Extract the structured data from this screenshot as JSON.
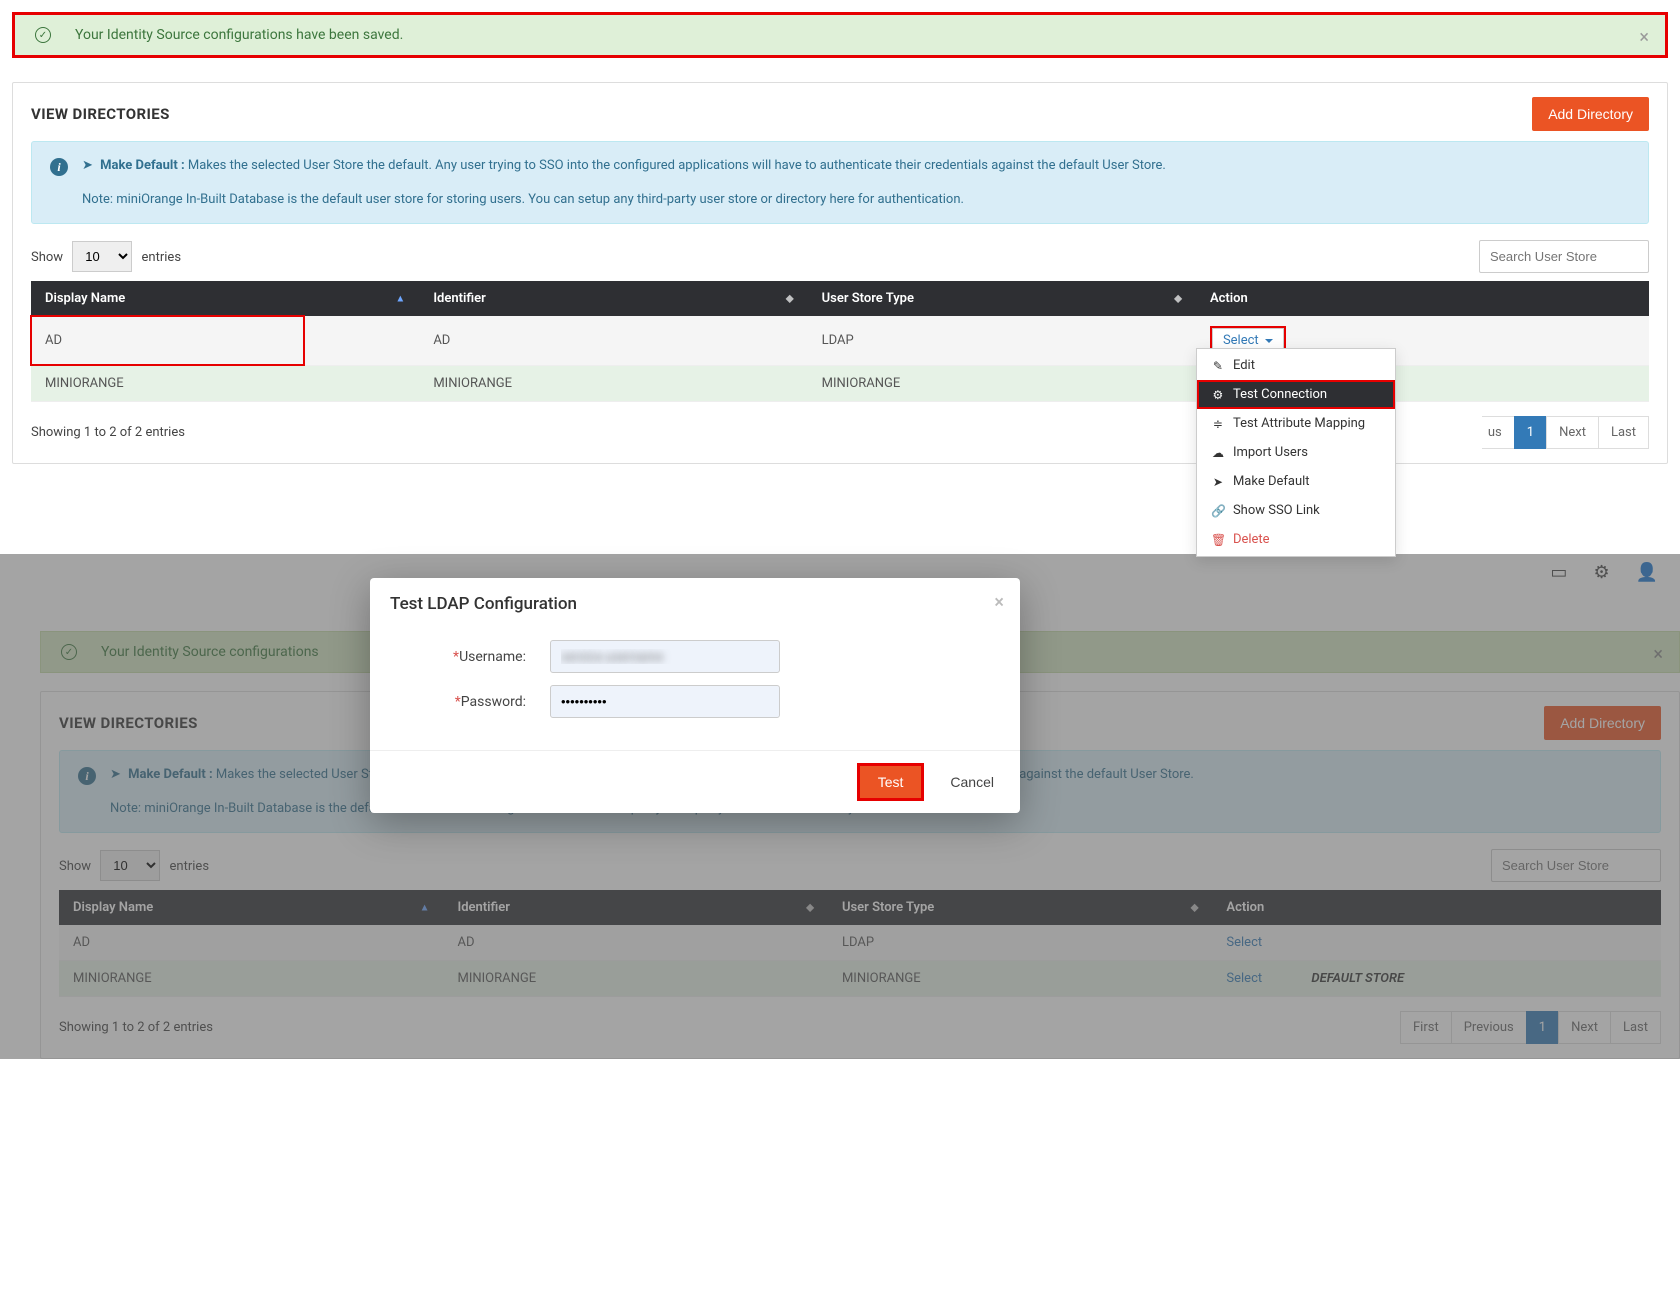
{
  "alert": {
    "message": "Your Identity Source configurations have been saved."
  },
  "panel": {
    "title": "VIEW DIRECTORIES",
    "add_button": "Add Directory"
  },
  "info": {
    "make_default_label": "Make Default :",
    "make_default_text": " Makes the selected User Store the default. Any user trying to SSO into the configured applications will have to authenticate their credentials against the default User Store.",
    "note": "Note: miniOrange In-Built Database is the default user store for storing users. You can setup any third-party user store or directory here for authentication."
  },
  "table": {
    "show_label": "Show",
    "entries_label": "entries",
    "show_value": "10",
    "search_placeholder": "Search User Store",
    "columns": {
      "display_name": "Display Name",
      "identifier": "Identifier",
      "user_store_type": "User Store Type",
      "action": "Action"
    },
    "rows": [
      {
        "display_name": "AD",
        "identifier": "AD",
        "user_store_type": "LDAP",
        "action": "Select"
      },
      {
        "display_name": "MINIORANGE",
        "identifier": "MINIORANGE",
        "user_store_type": "MINIORANGE",
        "action": "Select"
      }
    ],
    "footer": "Showing 1 to 2 of 2 entries",
    "pager_partial": "us",
    "pager": [
      "1",
      "Next",
      "Last"
    ],
    "pager_full": [
      "First",
      "Previous",
      "1",
      "Next",
      "Last"
    ],
    "default_store_label": "DEFAULT STORE"
  },
  "dropdown": {
    "edit": "Edit",
    "test_connection": "Test Connection",
    "test_attr_mapping": "Test Attribute Mapping",
    "import_users": "Import Users",
    "make_default": "Make Default",
    "show_sso_link": "Show SSO Link",
    "delete": "Delete"
  },
  "modal": {
    "title": "Test LDAP Configuration",
    "username_label": "Username:",
    "password_label": "Password:",
    "username_value": "service.username",
    "password_value": "••••••••••",
    "test_button": "Test",
    "cancel_button": "Cancel"
  },
  "second_alert": {
    "message": "Your Identity Source configurations"
  }
}
